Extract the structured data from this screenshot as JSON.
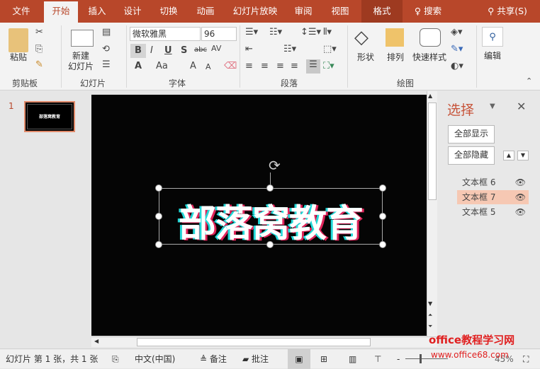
{
  "tabs": [
    "文件",
    "开始",
    "插入",
    "设计",
    "切换",
    "动画",
    "幻灯片放映",
    "审阅",
    "视图",
    "格式"
  ],
  "search_label": "搜索",
  "share_label": "共享(S)",
  "ribbon": {
    "clipboard": {
      "paste": "粘贴",
      "label": "剪贴板"
    },
    "slides": {
      "new_slide_1": "新建",
      "new_slide_2": "幻灯片",
      "label": "幻灯片"
    },
    "font": {
      "name": "微软雅黑",
      "size": "96",
      "label": "字体",
      "bold": "B",
      "italic": "I",
      "underline": "U",
      "shadow": "S",
      "strike": "abc",
      "spacing": "AV",
      "color": "A",
      "case": "Aa",
      "grow": "A",
      "shrink": "A"
    },
    "paragraph": {
      "label": "段落"
    },
    "drawing": {
      "shape": "形状",
      "arrange": "排列",
      "quick_styles": "快速样式",
      "label": "绘图"
    },
    "editing": {
      "label": "编辑"
    }
  },
  "thumbnail": {
    "number": "1",
    "text": "部落窝教育"
  },
  "slide": {
    "text": "部落窝教育"
  },
  "selection_pane": {
    "title": "选择",
    "show_all": "全部显示",
    "hide_all": "全部隐藏",
    "items": [
      {
        "label": "文本框 6",
        "selected": false
      },
      {
        "label": "文本框 7",
        "selected": true
      },
      {
        "label": "文本框 5",
        "selected": false
      }
    ]
  },
  "status": {
    "slide_info": "幻灯片 第 1 张，共 1 张",
    "language": "中文(中国)",
    "notes": "备注",
    "comments": "批注",
    "zoom": "45%"
  },
  "watermark": {
    "line1": "office教程学习网",
    "line2": "www.office68.com"
  },
  "colors": {
    "accent": "#b8472a",
    "selected_item": "#f6c8b3"
  }
}
